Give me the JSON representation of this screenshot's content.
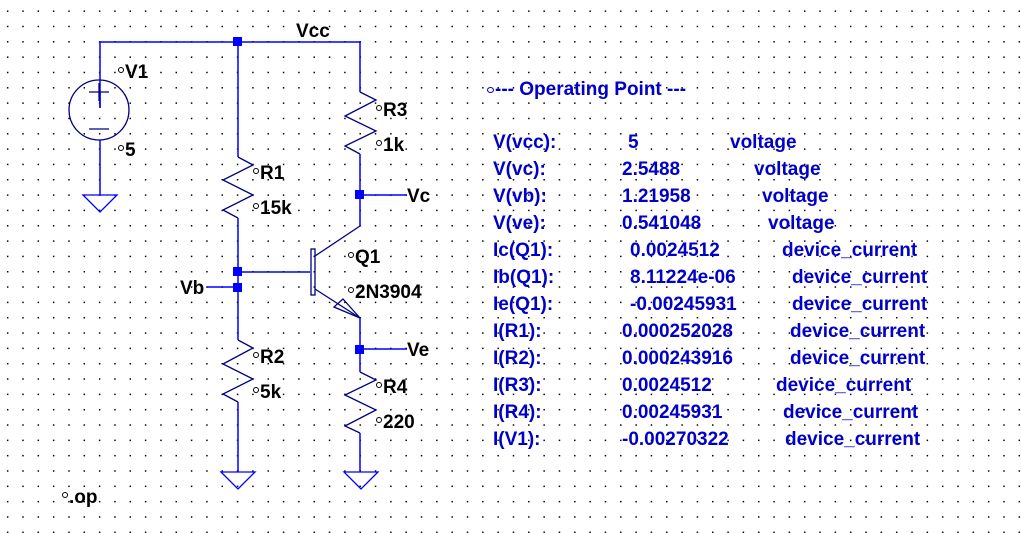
{
  "schematic": {
    "net_labels": {
      "vcc": "Vcc",
      "vc": "Vc",
      "vb": "Vb",
      "ve": "Ve"
    },
    "components": {
      "V1": {
        "name": "V1",
        "value": "5"
      },
      "R1": {
        "name": "R1",
        "value": "15k"
      },
      "R2": {
        "name": "R2",
        "value": "5k"
      },
      "R3": {
        "name": "R3",
        "value": "1k"
      },
      "R4": {
        "name": "R4",
        "value": "220"
      },
      "Q1": {
        "name": "Q1",
        "value": "2N3904"
      }
    },
    "directive": ".op"
  },
  "operating_point": {
    "title": "--- Operating Point ---",
    "rows": [
      {
        "name": "V(vcc):",
        "value": "5",
        "type": "voltage"
      },
      {
        "name": "V(vc):",
        "value": "2.5488",
        "type": "voltage"
      },
      {
        "name": "V(vb):",
        "value": "1.21958",
        "type": "voltage"
      },
      {
        "name": "V(ve):",
        "value": "0.541048",
        "type": "voltage"
      },
      {
        "name": "Ic(Q1):",
        "value": "0.0024512",
        "type": "device_current"
      },
      {
        "name": "Ib(Q1):",
        "value": "8.11224e-06",
        "type": "device_current"
      },
      {
        "name": "Ie(Q1):",
        "value": "-0.00245931",
        "type": "device_current"
      },
      {
        "name": "I(R1):",
        "value": "0.000252028",
        "type": "device_current"
      },
      {
        "name": "I(R2):",
        "value": "0.000243916",
        "type": "device_current"
      },
      {
        "name": "I(R3):",
        "value": "0.0024512",
        "type": "device_current"
      },
      {
        "name": "I(R4):",
        "value": "0.00245931",
        "type": "device_current"
      },
      {
        "name": "I(V1):",
        "value": "-0.00270322",
        "type": "device_current"
      }
    ]
  },
  "colors": {
    "wire": "#0000ff",
    "component": "#000080",
    "op_text": "#0000c8",
    "label_text": "#000000"
  }
}
